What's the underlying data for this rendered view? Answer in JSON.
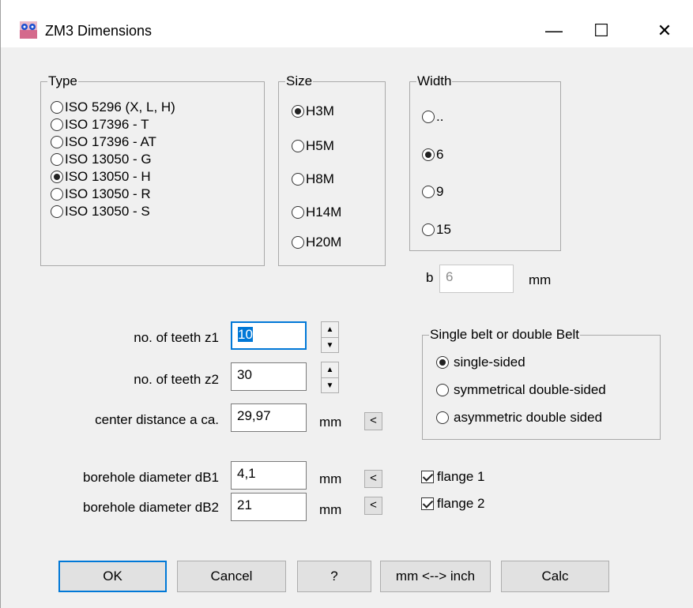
{
  "window": {
    "title": "ZM3 Dimensions",
    "minimize": "—",
    "maximize": "☐",
    "close": "✕"
  },
  "type_group": {
    "legend": "Type",
    "options": [
      {
        "label": "ISO 5296 (X, L, H)",
        "selected": false
      },
      {
        "label": "ISO 17396 - T",
        "selected": false
      },
      {
        "label": "ISO 17396 - AT",
        "selected": false
      },
      {
        "label": "ISO 13050 - G",
        "selected": false
      },
      {
        "label": "ISO 13050 - H",
        "selected": true
      },
      {
        "label": "ISO 13050 - R",
        "selected": false
      },
      {
        "label": "ISO 13050 - S",
        "selected": false
      }
    ]
  },
  "size_group": {
    "legend": "Size",
    "options": [
      {
        "label": "H3M",
        "selected": true
      },
      {
        "label": "H5M",
        "selected": false
      },
      {
        "label": "H8M",
        "selected": false
      },
      {
        "label": "H14M",
        "selected": false
      },
      {
        "label": "H20M",
        "selected": false
      }
    ]
  },
  "width_group": {
    "legend": "Width",
    "options": [
      {
        "label": "..",
        "selected": false
      },
      {
        "label": "6",
        "selected": true
      },
      {
        "label": "9",
        "selected": false
      },
      {
        "label": "15",
        "selected": false
      }
    ]
  },
  "b_field": {
    "label": "b",
    "value": "6",
    "unit": "mm"
  },
  "teeth_z1": {
    "label": "no. of teeth z1",
    "value": "10"
  },
  "teeth_z2": {
    "label": "no. of teeth z2",
    "value": "30"
  },
  "center_distance": {
    "label": "center distance a ca.",
    "value": "29,97",
    "unit": "mm",
    "button": "<"
  },
  "borehole_db1": {
    "label": "borehole diameter dB1",
    "value": "4,1",
    "unit": "mm",
    "button": "<"
  },
  "borehole_db2": {
    "label": "borehole diameter dB2",
    "value": "21",
    "unit": "mm",
    "button": "<"
  },
  "belt_group": {
    "legend": "Single belt or double Belt",
    "options": [
      {
        "label": "single-sided",
        "selected": true
      },
      {
        "label": "symmetrical double-sided",
        "selected": false
      },
      {
        "label": "asymmetric double sided",
        "selected": false
      }
    ]
  },
  "flange1": {
    "label": "flange 1",
    "checked": true
  },
  "flange2": {
    "label": "flange 2",
    "checked": true
  },
  "buttons": {
    "ok": "OK",
    "cancel": "Cancel",
    "help": "?",
    "convert": "mm <--> inch",
    "calc": "Calc"
  }
}
